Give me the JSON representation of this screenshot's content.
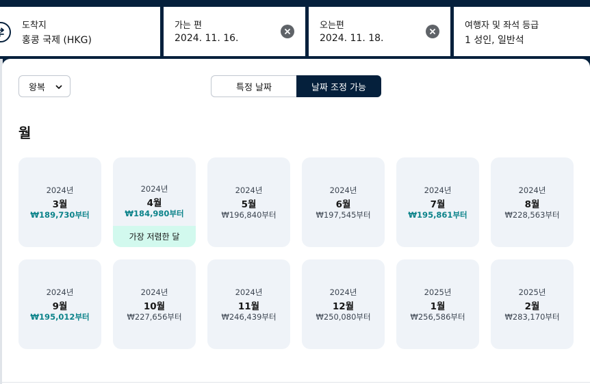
{
  "search": {
    "destination": {
      "label": "도착지",
      "value": "홍콩 국제 (HKG)"
    },
    "depart": {
      "label": "가는 편",
      "value": "2024. 11. 16."
    },
    "return": {
      "label": "오는편",
      "value": "2024. 11. 18."
    },
    "travelers": {
      "label": "여행자 및 좌석 등급",
      "value": "1 성인, 일반석"
    }
  },
  "panel": {
    "trip_type": "왕복",
    "date_mode": {
      "specific": "특정 날짜",
      "flexible": "날짜 조정 가능",
      "selected": "flexible"
    },
    "section_title": "월",
    "months": [
      {
        "year": "2024년",
        "month": "3월",
        "price": "₩189,730부터",
        "highlight": true
      },
      {
        "year": "2024년",
        "month": "4월",
        "price": "₩184,980부터",
        "highlight": true,
        "badge": "가장 저렴한 달"
      },
      {
        "year": "2024년",
        "month": "5월",
        "price": "₩196,840부터",
        "highlight": false
      },
      {
        "year": "2024년",
        "month": "6월",
        "price": "₩197,545부터",
        "highlight": false
      },
      {
        "year": "2024년",
        "month": "7월",
        "price": "₩195,861부터",
        "highlight": true
      },
      {
        "year": "2024년",
        "month": "8월",
        "price": "₩228,563부터",
        "highlight": false
      },
      {
        "year": "2024년",
        "month": "9월",
        "price": "₩195,012부터",
        "highlight": true
      },
      {
        "year": "2024년",
        "month": "10월",
        "price": "₩227,656부터",
        "highlight": false
      },
      {
        "year": "2024년",
        "month": "11월",
        "price": "₩246,439부터",
        "highlight": false
      },
      {
        "year": "2024년",
        "month": "12월",
        "price": "₩250,080부터",
        "highlight": false
      },
      {
        "year": "2025년",
        "month": "1월",
        "price": "₩256,586부터",
        "highlight": false
      },
      {
        "year": "2025년",
        "month": "2월",
        "price": "₩283,170부터",
        "highlight": false
      }
    ]
  },
  "colors": {
    "brand_dark": "#05203c",
    "card_bg": "#eff3f8",
    "price_highlight": "#0c838a",
    "badge_bg": "#d2f9ee"
  },
  "icons": {
    "swap": "swap-arrows-icon",
    "clear": "clear-x-icon",
    "dropdown": "chevron-down-icon"
  }
}
